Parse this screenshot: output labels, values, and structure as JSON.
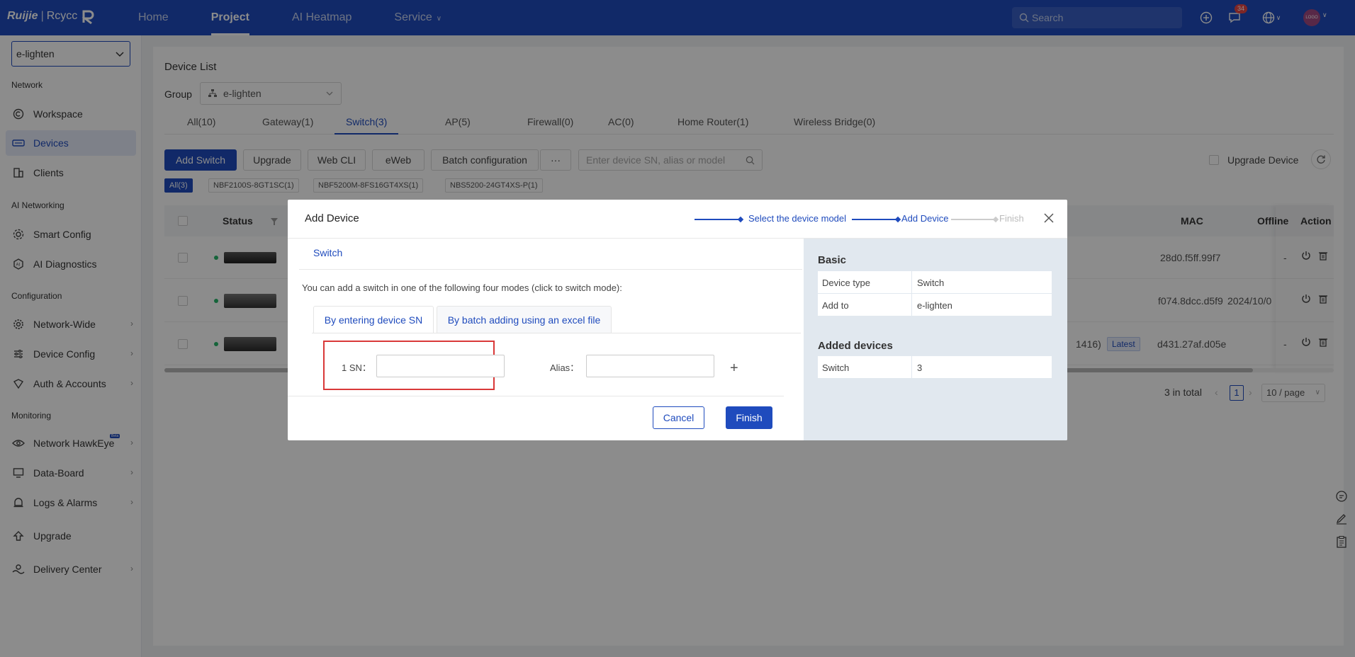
{
  "topbar": {
    "logo_brand": "Ruijie",
    "logo_product": "Rcycc",
    "nav": [
      {
        "label": "Home"
      },
      {
        "label": "Project"
      },
      {
        "label": "AI Heatmap"
      },
      {
        "label": "Service"
      }
    ],
    "search_placeholder": "Search",
    "message_badge": "34",
    "avatar_text": "LOGO",
    "accent": "#1f4bbd"
  },
  "sidebar": {
    "org": "e-lighten",
    "sections": {
      "network": "Network",
      "ai": "AI Networking",
      "config": "Configuration",
      "monitoring": "Monitoring"
    },
    "items": [
      {
        "label": "Workspace"
      },
      {
        "label": "Devices"
      },
      {
        "label": "Clients"
      },
      {
        "label": "Smart Config"
      },
      {
        "label": "AI Diagnostics"
      },
      {
        "label": "Network-Wide"
      },
      {
        "label": "Device Config"
      },
      {
        "label": "Auth & Accounts"
      },
      {
        "label": "Network HawkEye"
      },
      {
        "label": "Data-Board"
      },
      {
        "label": "Logs & Alarms"
      },
      {
        "label": "Upgrade"
      },
      {
        "label": "Delivery Center"
      }
    ],
    "beta": "Beta"
  },
  "main": {
    "title": "Device List",
    "group_label": "Group",
    "group_value": "e-lighten",
    "tabs": [
      "All(10)",
      "Gateway(1)",
      "Switch(3)",
      "AP(5)",
      "Firewall(0)",
      "AC(0)",
      "Home Router(1)",
      "Wireless Bridge(0)"
    ],
    "buttons": {
      "add": "Add Switch",
      "upgrade": "Upgrade",
      "webcli": "Web CLI",
      "eweb": "eWeb",
      "batch": "Batch configuration",
      "more": "···"
    },
    "search_placeholder": "Enter device SN, alias or model",
    "upgrade_device": "Upgrade Device",
    "filters": [
      "All(3)",
      "NBF2100S-8GT1SC(1)",
      "NBF5200M-8FS16GT4XS(1)",
      "NBS5200-24GT4XS-P(1)"
    ],
    "columns": {
      "status": "Status",
      "mac": "MAC",
      "offline": "Offline",
      "action": "Action"
    },
    "rows": [
      {
        "mac": "28d0.f5ff.99f7",
        "offline": "-"
      },
      {
        "mac": "f074.8dcc.d5f9",
        "offline": "2024/10/0"
      },
      {
        "mac": "d431.27af.d05e",
        "offline": "-",
        "version_tail": "1416)",
        "latest": "Latest"
      }
    ],
    "total": "3 in total",
    "page": "1",
    "page_size": "10 / page"
  },
  "modal": {
    "title": "Add Device",
    "steps": [
      "Select the device model",
      "Add Device",
      "Finish"
    ],
    "sub_tab": "Switch",
    "hint": "You can add a switch in one of the following four modes (click to switch mode):",
    "mode_tabs": [
      "By entering device SN",
      "By batch adding using an excel file"
    ],
    "sn_label": "1 SN：",
    "alias_label": "Alias：",
    "plus": "+",
    "cancel": "Cancel",
    "finish": "Finish",
    "right": {
      "basic_title": "Basic",
      "device_type_key": "Device type",
      "device_type_val": "Switch",
      "add_to_key": "Add to",
      "add_to_val": "e-lighten",
      "added_title": "Added devices",
      "added_key": "Switch",
      "added_val": "3"
    }
  }
}
